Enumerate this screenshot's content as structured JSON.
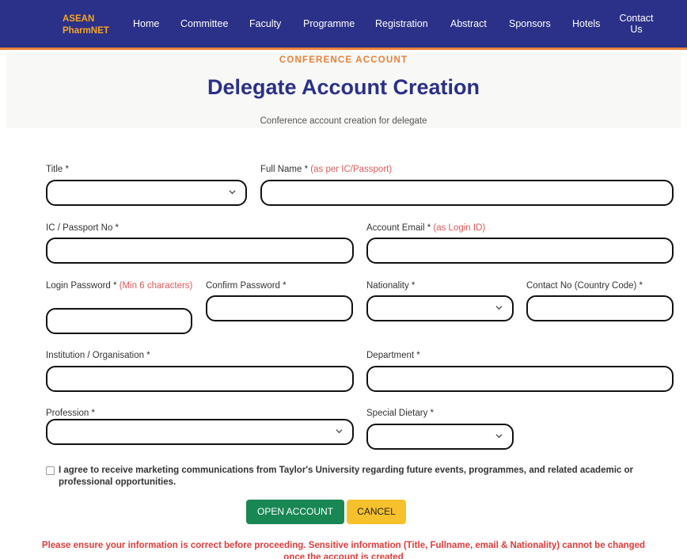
{
  "nav": {
    "brand_line1": "ASEAN",
    "brand_line2": "PharmNET",
    "links": [
      "Home",
      "Committee",
      "Faculty",
      "Programme",
      "Registration",
      "Abstract",
      "Sponsors",
      "Hotels",
      "Contact Us"
    ]
  },
  "hero": {
    "kicker": "CONFERENCE ACCOUNT",
    "title": "Delegate Account Creation",
    "subtitle": "Conference account creation for delegate"
  },
  "form": {
    "title": {
      "label": "Title *",
      "value": ""
    },
    "full_name": {
      "label": "Full Name *",
      "hint": "(as per IC/Passport)",
      "value": ""
    },
    "ic_passport": {
      "label": "IC / Passport No *",
      "value": ""
    },
    "account_email": {
      "label": "Account Email *",
      "hint": "(as Login ID)",
      "value": ""
    },
    "login_password": {
      "label": "Login Password *",
      "hint": "(Min 6 characters)",
      "value": ""
    },
    "confirm_password": {
      "label": "Confirm Password *",
      "value": ""
    },
    "nationality": {
      "label": "Nationality *",
      "value": ""
    },
    "contact_no": {
      "label": "Contact No (Country Code) *",
      "value": ""
    },
    "institution": {
      "label": "Institution / Organisation *",
      "value": ""
    },
    "department": {
      "label": "Department *",
      "value": ""
    },
    "profession": {
      "label": "Profession *",
      "value": ""
    },
    "special_dietary": {
      "label": "Special Dietary *",
      "value": ""
    }
  },
  "consent": {
    "checked": false,
    "text": "I agree to receive marketing communications from Taylor's University regarding future events, programmes, and related academic or professional opportunities."
  },
  "actions": {
    "open_label": "OPEN ACCOUNT",
    "cancel_label": "CANCEL"
  },
  "warning": "Please ensure your information is correct before proceeding. Sensitive information (Title, Fullname, email & Nationality) cannot be changed once the account is created",
  "colors": {
    "nav_bg": "#2b3088",
    "accent_orange": "#e8823a",
    "brand_text": "#f5a623",
    "title_navy": "#2b3088",
    "hint_red": "#e05a5a",
    "open_button": "#198754",
    "cancel_button": "#f6c12a",
    "warning_red": "#e03c3c"
  },
  "icons": {
    "select_chevron": "chevron-down-icon",
    "checkbox": "checkbox-icon"
  }
}
